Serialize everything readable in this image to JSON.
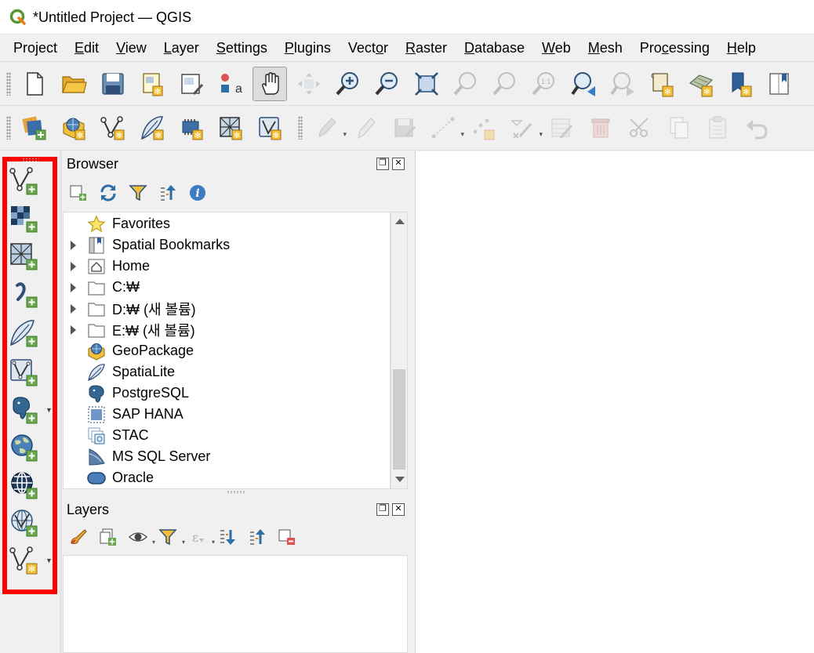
{
  "window": {
    "title": "*Untitled Project — QGIS",
    "icon": "qgis-logo-icon"
  },
  "menubar": [
    {
      "label": "Project",
      "mnemonic": "j"
    },
    {
      "label": "Edit",
      "mnemonic": "E"
    },
    {
      "label": "View",
      "mnemonic": "V"
    },
    {
      "label": "Layer",
      "mnemonic": "L"
    },
    {
      "label": "Settings",
      "mnemonic": "S"
    },
    {
      "label": "Plugins",
      "mnemonic": "P"
    },
    {
      "label": "Vector",
      "mnemonic": "o"
    },
    {
      "label": "Raster",
      "mnemonic": "R"
    },
    {
      "label": "Database",
      "mnemonic": "D"
    },
    {
      "label": "Web",
      "mnemonic": "W"
    },
    {
      "label": "Mesh",
      "mnemonic": "M"
    },
    {
      "label": "Processing",
      "mnemonic": "c"
    },
    {
      "label": "Help",
      "mnemonic": "H"
    }
  ],
  "toolbar1": [
    "new-project-icon",
    "open-project-icon",
    "save-project-icon",
    "new-print-layout-icon",
    "layout-manager-icon",
    "style-manager-icon",
    "pan-icon",
    "pan-to-selection-icon",
    "zoom-in-icon",
    "zoom-out-icon",
    "zoom-full-icon",
    "zoom-to-selection-icon",
    "zoom-to-layer-icon",
    "zoom-native-icon",
    "zoom-last-icon",
    "zoom-next-icon",
    "new-map-view-icon",
    "new-3d-map-view-icon",
    "new-bookmark-icon",
    "show-bookmarks-icon"
  ],
  "toolbar2": [
    "data-source-manager-icon",
    "new-geopackage-layer-icon",
    "new-shapefile-layer-icon",
    "new-spatialite-layer-icon",
    "new-temporary-layer-icon",
    "new-virtual-layer-icon",
    "new-mesh-layer-icon",
    "current-edits-icon",
    "toggle-editing-icon",
    "save-edits-icon",
    "digitize-icon",
    "vertex-tool-icon",
    "modify-attributes-icon",
    "delete-selected-icon",
    "cut-features-icon",
    "copy-features-icon",
    "paste-features-icon",
    "undo-icon"
  ],
  "left_toolbar": [
    "add-vector-layer-icon",
    "add-raster-layer-icon",
    "add-mesh-layer-icon",
    "add-delimited-text-layer-icon",
    "add-spatialite-layer-icon",
    "add-virtual-layer-icon",
    "add-postgis-layer-icon",
    "add-wms-wmts-layer-icon",
    "add-wfs-layer-icon",
    "add-wcs-layer-icon",
    "new-layer-icon"
  ],
  "browser": {
    "title": "Browser",
    "toolbar": [
      "add-selected-layers-icon",
      "refresh-icon",
      "filter-icon",
      "collapse-all-icon",
      "properties-icon"
    ],
    "items": [
      {
        "label": "Favorites",
        "icon": "star-icon",
        "expandable": false
      },
      {
        "label": "Spatial Bookmarks",
        "icon": "bookmarks-icon",
        "expandable": true
      },
      {
        "label": "Home",
        "icon": "home-folder-icon",
        "expandable": true
      },
      {
        "label": "C:₩",
        "icon": "folder-icon",
        "expandable": true
      },
      {
        "label": "D:₩ (새 볼륨)",
        "icon": "folder-icon",
        "expandable": true
      },
      {
        "label": "E:₩ (새 볼륨)",
        "icon": "folder-icon",
        "expandable": true
      },
      {
        "label": "GeoPackage",
        "icon": "geopackage-icon",
        "expandable": false
      },
      {
        "label": "SpatiaLite",
        "icon": "spatialite-icon",
        "expandable": false
      },
      {
        "label": "PostgreSQL",
        "icon": "postgresql-icon",
        "expandable": false
      },
      {
        "label": "SAP HANA",
        "icon": "sap-hana-icon",
        "expandable": false
      },
      {
        "label": "STAC",
        "icon": "stac-icon",
        "expandable": false
      },
      {
        "label": "MS SQL Server",
        "icon": "mssql-icon",
        "expandable": false
      },
      {
        "label": "Oracle",
        "icon": "oracle-icon",
        "expandable": false
      }
    ]
  },
  "layers": {
    "title": "Layers",
    "toolbar": [
      "style-panel-icon",
      "add-group-icon",
      "visibility-icon",
      "filter-legend-icon",
      "filter-expression-icon",
      "expand-all-icon",
      "collapse-all-icon",
      "remove-layer-icon"
    ]
  },
  "colors": {
    "highlight_box": "#ff0000",
    "canvas": "#ffffff",
    "chrome": "#f0f0f0"
  }
}
